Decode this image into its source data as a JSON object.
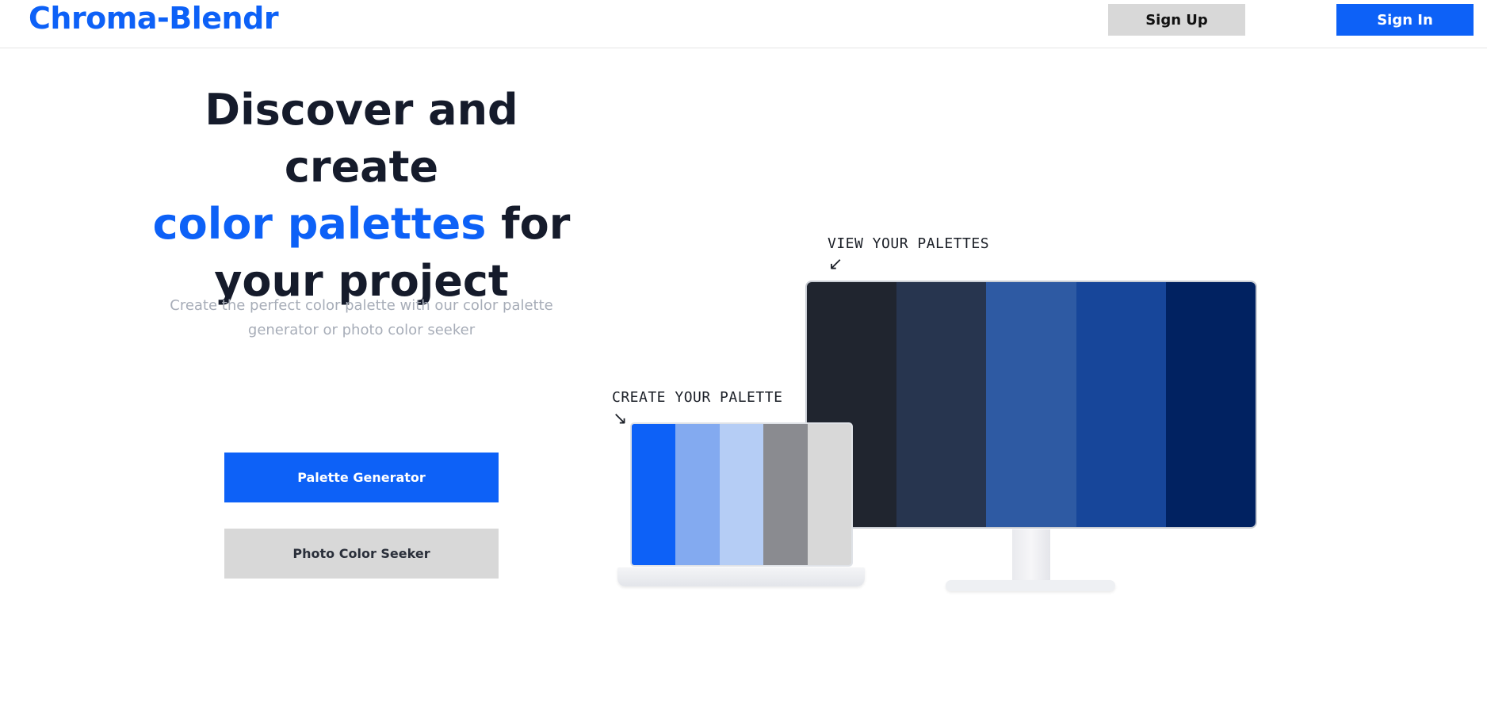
{
  "header": {
    "brand": "Chroma-Blendr",
    "signup_label": "Sign Up",
    "signin_label": "Sign In"
  },
  "hero": {
    "title_line1": "Discover and create",
    "title_accent": "color palettes",
    "title_line2_rest": " for",
    "title_line3": "your project",
    "subtitle": "Create the perfect color palette with our color palette generator or photo color seeker",
    "generator_label": "Palette Generator",
    "seeker_label": "Photo Color Seeker"
  },
  "illustration": {
    "view_note": "VIEW YOUR PALETTES",
    "create_note": "CREATE YOUR PALETTE",
    "monitor_palette": [
      "#20252f",
      "#27354f",
      "#2e5aa3",
      "#17469a",
      "#012261"
    ],
    "laptop_palette": [
      "#0d61f7",
      "#83aaf0",
      "#b5cdf5",
      "#8a8b90",
      "#d8d8d8"
    ]
  },
  "colors": {
    "accent": "#0d61f7",
    "heading": "#151b2b",
    "muted": "#a7adb8",
    "secondary_button": "#d8d8d8"
  }
}
